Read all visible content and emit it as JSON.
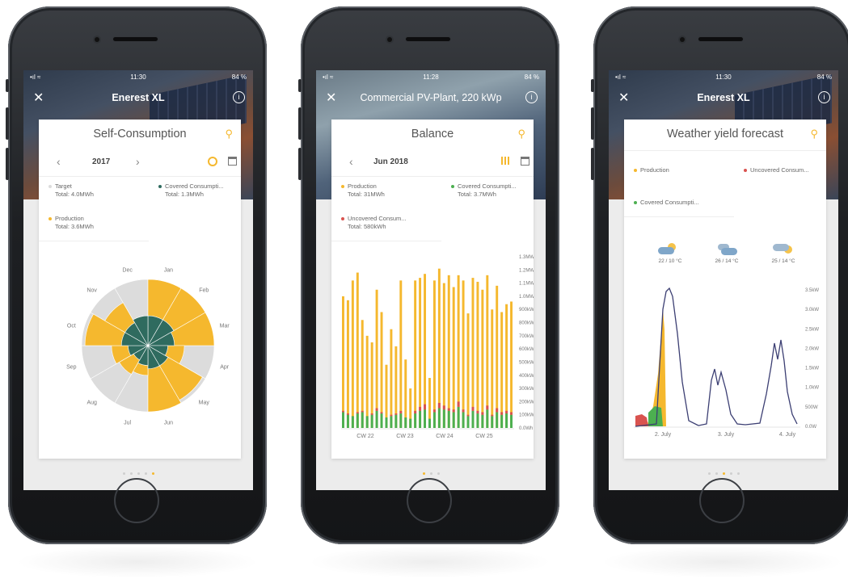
{
  "status": {
    "p1": {
      "time": "11:30",
      "battery": "84 %"
    },
    "p2": {
      "time": "11:28",
      "battery": "84 %"
    },
    "p3": {
      "time": "11:30",
      "battery": "84 %"
    }
  },
  "phone1": {
    "nav_title": "Enerest XL",
    "card_title": "Self-Consumption",
    "year": "2017",
    "prev": "‹",
    "next": "›",
    "legend": [
      {
        "name": "Target",
        "total": "Total: 4.0MWh",
        "color": "#dcdcdc"
      },
      {
        "name": "Covered Consumpti...",
        "total": "Total: 1.3MWh",
        "color": "#2f6b5f"
      },
      {
        "name": "Production",
        "total": "Total: 3.6MWh",
        "color": "#f5b82e"
      }
    ],
    "months": [
      "Jan",
      "Feb",
      "Mar",
      "Apr",
      "May",
      "Jun",
      "Jul",
      "Aug",
      "Sep",
      "Oct",
      "Nov",
      "Dec"
    ],
    "pager_active": 4
  },
  "phone2": {
    "nav_title": "Commercial PV-Plant, 220 kWp",
    "card_title": "Balance",
    "period": "Jun 2018",
    "prev": "‹",
    "legend": [
      {
        "name": "Production",
        "total": "Total: 31MWh",
        "color": "#f5b82e"
      },
      {
        "name": "Covered Consumpti...",
        "total": "Total: 3.7MWh",
        "color": "#4caf50"
      },
      {
        "name": "Uncovered Consum...",
        "total": "Total: 580kWh",
        "color": "#d9534f"
      }
    ],
    "pager_active": 0
  },
  "phone3": {
    "nav_title": "Enerest XL",
    "card_title": "Weather yield forecast",
    "legend": [
      {
        "name": "Production",
        "color": "#f5b82e"
      },
      {
        "name": "Uncovered Consum...",
        "color": "#d9534f"
      },
      {
        "name": "Covered Consumpti...",
        "color": "#4caf50"
      }
    ],
    "weather": [
      {
        "icon": "partly-sunny-icon",
        "temp": "22 / 10 °C"
      },
      {
        "icon": "cloudy-icon",
        "temp": "26 / 14 °C"
      },
      {
        "icon": "partly-sunny-icon",
        "temp": "25 / 14 °C"
      }
    ],
    "pager_active": 2
  },
  "chart_data": [
    {
      "type": "polar-area",
      "categories": [
        "Jan",
        "Feb",
        "Mar",
        "Apr",
        "May",
        "Jun",
        "Jul",
        "Aug",
        "Sep",
        "Oct",
        "Nov",
        "Dec"
      ],
      "series": [
        {
          "name": "Target",
          "values": [
            1,
            1,
            1,
            1,
            1,
            1,
            1,
            1,
            1,
            1,
            1,
            1
          ]
        },
        {
          "name": "Production",
          "values": [
            1.0,
            1.0,
            1.0,
            0.55,
            0.95,
            1.0,
            0.45,
            0.5,
            0.55,
            0.95,
            0.75,
            0.45
          ]
        },
        {
          "name": "Covered Consumpti...",
          "values": [
            0.45,
            0.45,
            0.4,
            0.3,
            0.35,
            0.35,
            0.3,
            0.25,
            0.3,
            0.4,
            0.4,
            0.45
          ]
        }
      ]
    },
    {
      "type": "bar",
      "categories": [
        "CW 22",
        "CW 23",
        "CW 24",
        "CW 25"
      ],
      "y_ticks": [
        "1.3MWh",
        "1.2MWh",
        "1.1MWh",
        "1.0MWh",
        "900kWh",
        "800kWh",
        "700kWh",
        "600kWh",
        "500kWh",
        "400kWh",
        "300kWh",
        "200kWh",
        "100kWh",
        "0.0Wh"
      ],
      "series": [
        {
          "name": "Production",
          "values": [
            1.0,
            0.97,
            1.12,
            1.18,
            0.82,
            0.7,
            0.65,
            1.05,
            0.88,
            0.48,
            0.75,
            0.62,
            1.12,
            0.52,
            0.3,
            1.12,
            1.14,
            1.17,
            0.38,
            1.12,
            1.21,
            1.1,
            1.16,
            1.07,
            1.16,
            1.12,
            0.87,
            1.14,
            1.11,
            1.05,
            1.16,
            0.9,
            1.08,
            0.88,
            0.94,
            0.96
          ]
        },
        {
          "name": "Covered Consumpti...",
          "values": [
            0.12,
            0.1,
            0.09,
            0.11,
            0.12,
            0.09,
            0.1,
            0.13,
            0.11,
            0.08,
            0.09,
            0.1,
            0.11,
            0.08,
            0.07,
            0.11,
            0.13,
            0.14,
            0.07,
            0.12,
            0.15,
            0.14,
            0.13,
            0.12,
            0.16,
            0.12,
            0.09,
            0.13,
            0.11,
            0.1,
            0.14,
            0.09,
            0.12,
            0.1,
            0.11,
            0.1
          ]
        },
        {
          "name": "Uncovered Consum...",
          "values": [
            0.01,
            0.01,
            0.0,
            0.01,
            0.01,
            0.0,
            0.01,
            0.02,
            0.01,
            0.0,
            0.01,
            0.01,
            0.02,
            0.0,
            0.0,
            0.02,
            0.03,
            0.04,
            0.0,
            0.02,
            0.04,
            0.03,
            0.02,
            0.02,
            0.04,
            0.02,
            0.01,
            0.03,
            0.02,
            0.02,
            0.03,
            0.01,
            0.03,
            0.02,
            0.02,
            0.02
          ]
        }
      ]
    },
    {
      "type": "line",
      "categories": [
        "2. July",
        "3. July",
        "4. July"
      ],
      "y_ticks": [
        "3.5kW",
        "3.0kW",
        "2.5kW",
        "2.0kW",
        "1.5kW",
        "1.0kW",
        "500W",
        "0.0W"
      ]
    }
  ]
}
